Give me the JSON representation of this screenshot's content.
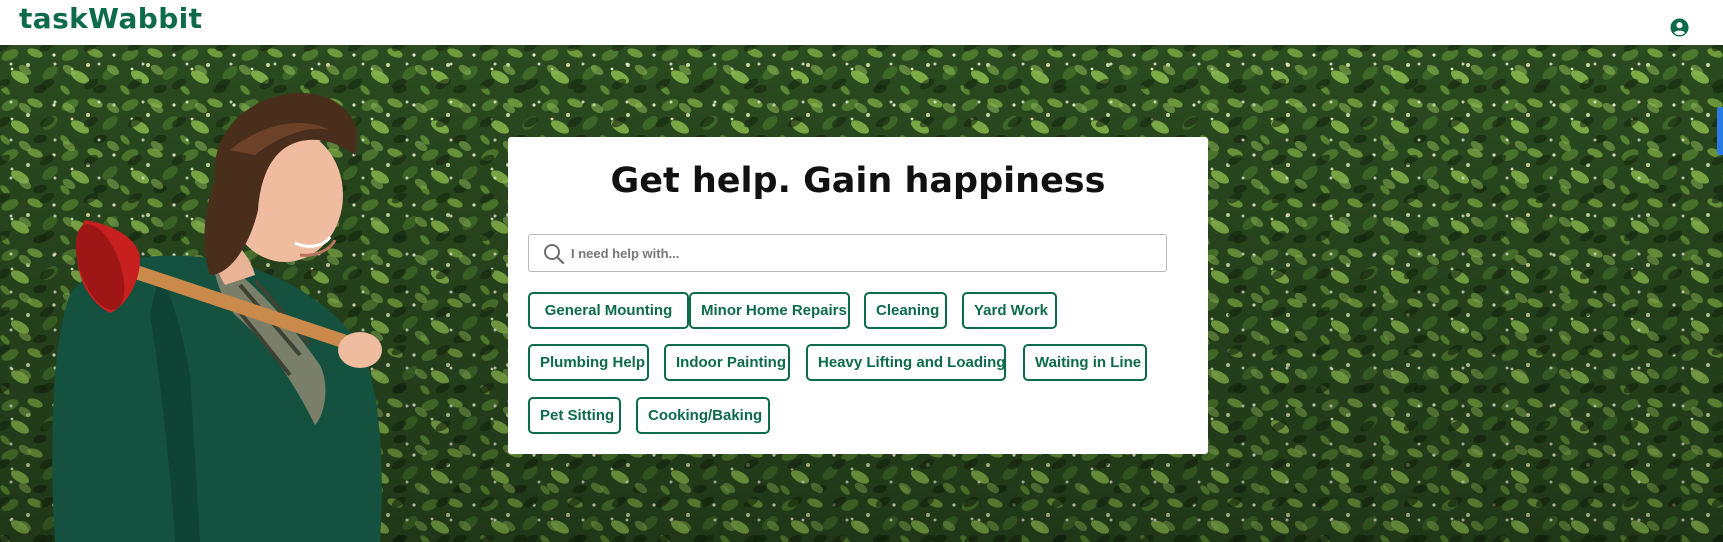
{
  "header": {
    "logo_text": "taskWabbit",
    "account_icon": "user-circle-icon"
  },
  "hero": {
    "title": "Get help. Gain happiness",
    "search": {
      "placeholder": "I need help with...",
      "value": "",
      "icon": "search-icon"
    },
    "categories": [
      "General Mounting",
      "Minor Home Repairs",
      "Cleaning",
      "Yard Work",
      "Plumbing Help",
      "Indoor Painting",
      "Heavy Lifting and Loading",
      "Waiting in Line",
      "Pet Sitting",
      "Cooking/Baking"
    ]
  },
  "colors": {
    "brand_green": "#0d6b4a",
    "title_text": "#111111",
    "background_foliage": "#233f19",
    "scroll_marker": "#2c7be5"
  }
}
